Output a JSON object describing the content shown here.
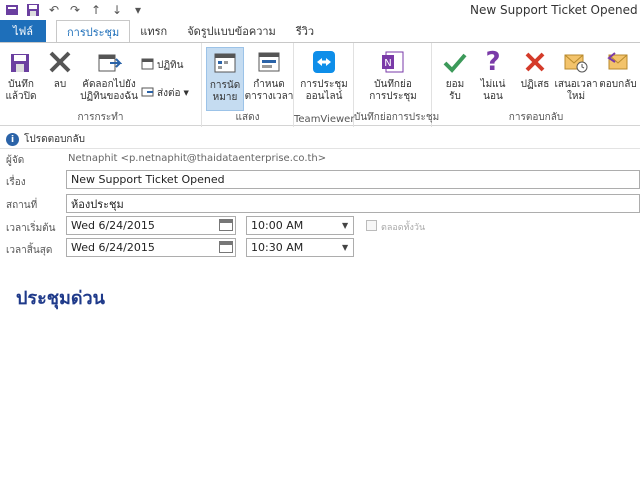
{
  "window": {
    "title": "New Support Ticket Opened"
  },
  "quick_access": {
    "icons": [
      "save-icon",
      "undo-icon",
      "redo-icon",
      "up-icon",
      "down-icon",
      "customize-icon"
    ]
  },
  "tabs": [
    {
      "label": "ไฟล์"
    },
    {
      "label": "การประชุม"
    },
    {
      "label": "แทรก"
    },
    {
      "label": "จัดรูปแบบข้อความ"
    },
    {
      "label": "รีวิว"
    }
  ],
  "ribbon": {
    "actions": {
      "save_close": "บันทึก\nแล้วปิด",
      "delete": "ลบ",
      "copy_calendar": "คัดลอกไปยัง\nปฏิทินของฉัน",
      "calendar": "ปฏิทิน",
      "forward": "ส่งต่อ",
      "label": "การกระทำ"
    },
    "show": {
      "appointment": "การนัด\nหมาย",
      "schedule": "กำหนด\nตารางเวลา",
      "label": "แสดง"
    },
    "teamviewer": {
      "online_meeting": "การประชุม\nออนไลน์",
      "label": "TeamViewer"
    },
    "onenote": {
      "meeting_notes": "บันทึกย่อ\nการประชุม",
      "label": "บันทึกย่อการประชุม"
    },
    "respond": {
      "accept": "ยอม\nรับ",
      "tentative": "ไม่แน่\nนอน",
      "decline": "ปฏิเสธ",
      "propose": "เสนอเวลา\nใหม่",
      "respond": "ตอบกลับ",
      "label": "การตอบกลับ"
    }
  },
  "infobar": {
    "text": "โปรดตอบกลับ"
  },
  "form": {
    "from_label": "ผู้จัด",
    "from_value": "Netnaphit <p.netnaphit@thaidataenterprise.co.th>",
    "subject_label": "เรื่อง",
    "subject_value": "New Support Ticket Opened",
    "location_label": "สถานที่",
    "location_value": "ห้องประชุม",
    "start_label": "เวลาเริ่มต้น",
    "start_date": "Wed 6/24/2015",
    "start_time": "10:00 AM",
    "end_label": "เวลาสิ้นสุด",
    "end_date": "Wed 6/24/2015",
    "end_time": "10:30 AM",
    "all_day_label": "ตลอดทั้งวัน"
  },
  "body": {
    "text": "ประชุมด่วน"
  },
  "colors": {
    "accent": "#1e6fba",
    "body_text": "#1f3a8a"
  }
}
